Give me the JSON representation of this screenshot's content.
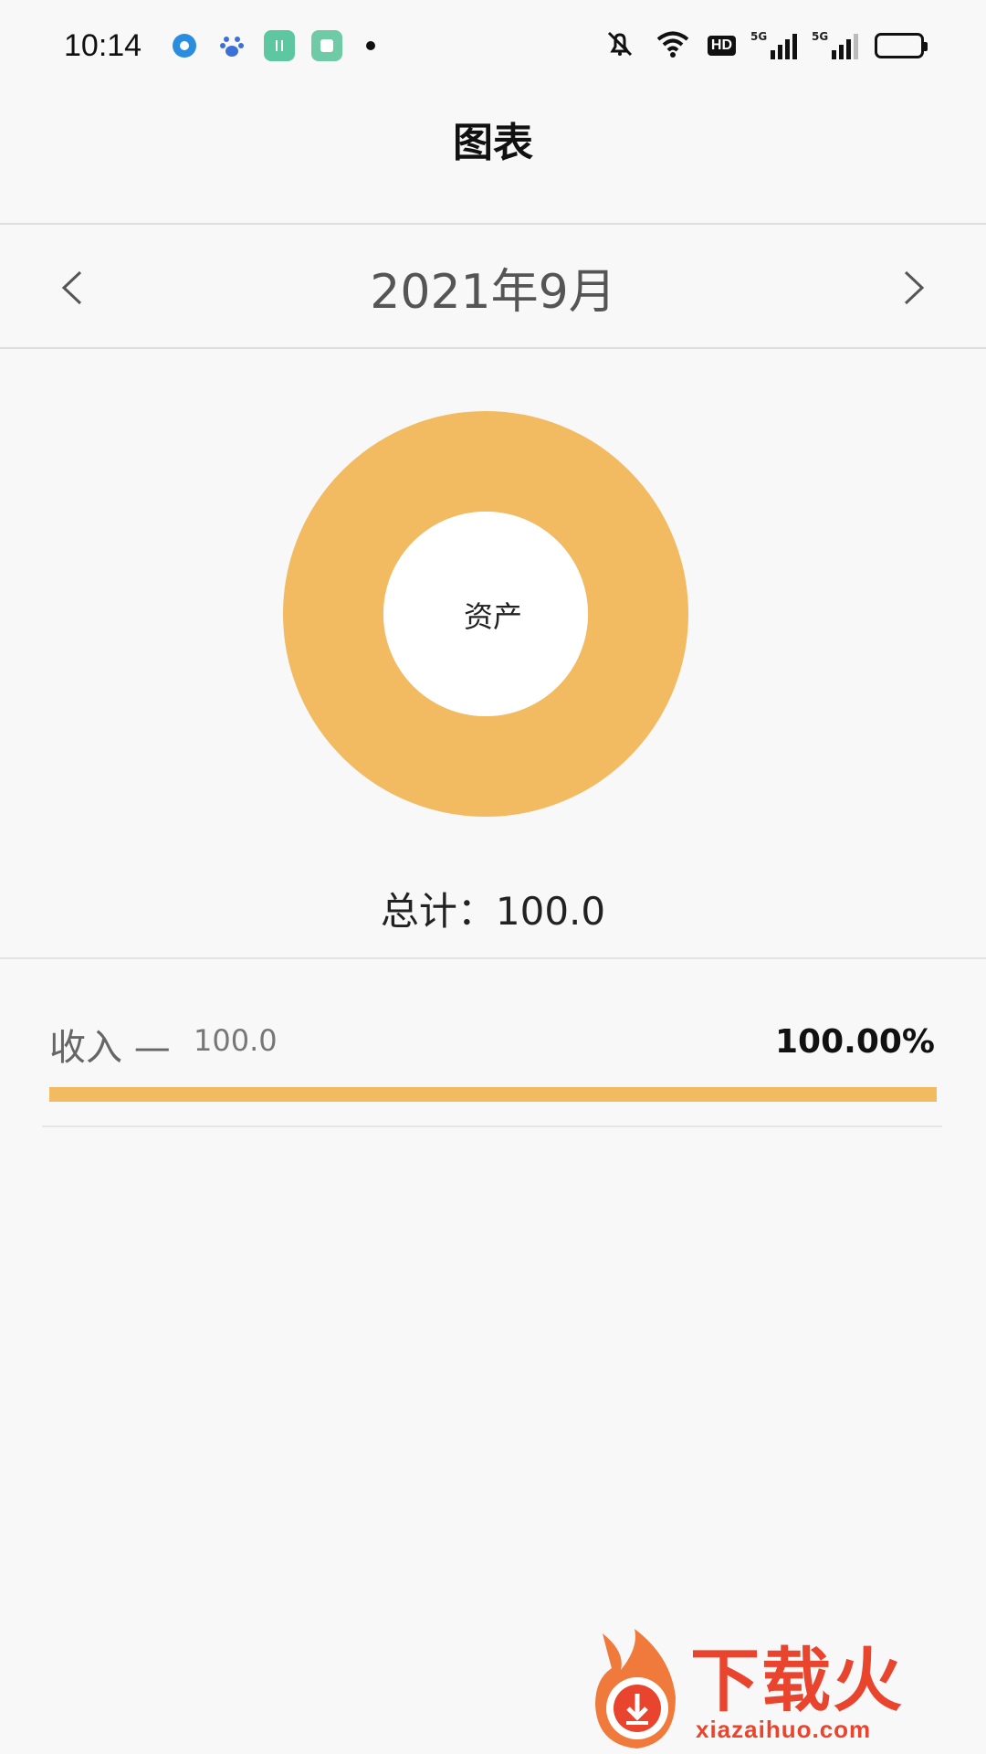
{
  "status_bar": {
    "time": "10:14",
    "hd_label": "HD",
    "sim1_label": "5G",
    "sim2_label": "5G"
  },
  "header": {
    "title": "图表"
  },
  "month_nav": {
    "label": "2021年9月"
  },
  "chart_data": {
    "type": "pie",
    "center_label": "资产",
    "series": [
      {
        "name": "收入",
        "value": 100.0
      }
    ],
    "colors": [
      "#f2bb62"
    ]
  },
  "summary": {
    "total_text": "总计：100.0"
  },
  "list": {
    "items": [
      {
        "name": "收入 —",
        "amount": "100.0",
        "percent_text": "100.00%",
        "fraction": 1.0
      }
    ]
  },
  "watermark": {
    "text": "下载火",
    "sub": "xiazaihuo.com"
  },
  "colors": {
    "accent": "#f2bb62",
    "background": "#f8f8f8",
    "watermark": "#e9452e"
  }
}
